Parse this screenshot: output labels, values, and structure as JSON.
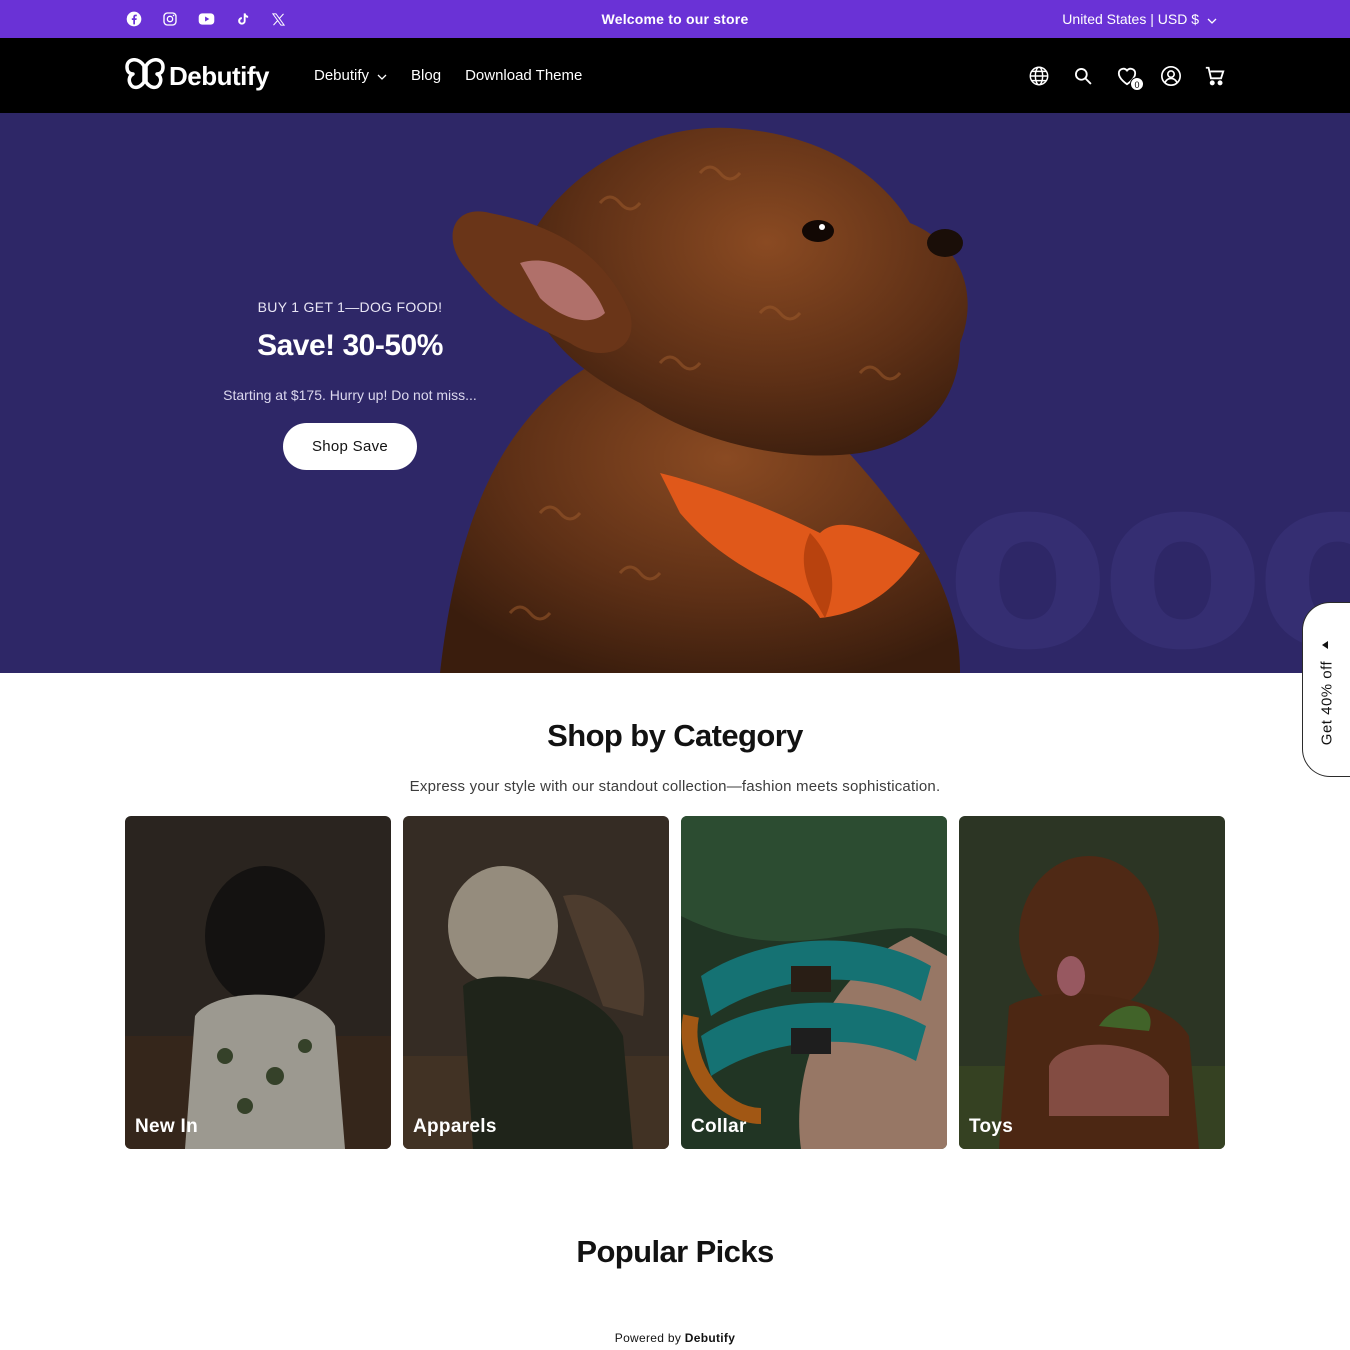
{
  "announcement": {
    "text": "Welcome to our store",
    "locale": "United States | USD $",
    "background": "#6a32d6",
    "social_icons": [
      "facebook-icon",
      "instagram-icon",
      "youtube-icon",
      "tiktok-icon",
      "x-twitter-icon"
    ]
  },
  "header": {
    "logo_text": "Debutify",
    "nav": [
      {
        "label": "Debutify",
        "has_dropdown": true
      },
      {
        "label": "Blog",
        "has_dropdown": false
      },
      {
        "label": "Download Theme",
        "has_dropdown": false
      }
    ],
    "icons": [
      "globe-icon",
      "search-icon",
      "wishlist-heart-icon",
      "account-icon",
      "cart-icon"
    ],
    "wishlist_count": "0"
  },
  "hero": {
    "eyebrow": "BUY 1 GET 1—DOG FOOD!",
    "title": "Save! 30-50%",
    "subtitle": "Starting at $175. Hurry up! Do not miss...",
    "button_label": "Shop Save",
    "background": "#2e2767"
  },
  "side_tab": {
    "label": "Get 40% off"
  },
  "category": {
    "title": "Shop by Category",
    "subtitle": "Express your style with our standout collection—fashion meets sophistication.",
    "cards": [
      {
        "label": "New In"
      },
      {
        "label": "Apparels"
      },
      {
        "label": "Collar"
      },
      {
        "label": "Toys"
      }
    ]
  },
  "popular": {
    "title": "Popular Picks"
  },
  "footer": {
    "powered_prefix": "Powered by",
    "powered_brand": "Debutify"
  }
}
